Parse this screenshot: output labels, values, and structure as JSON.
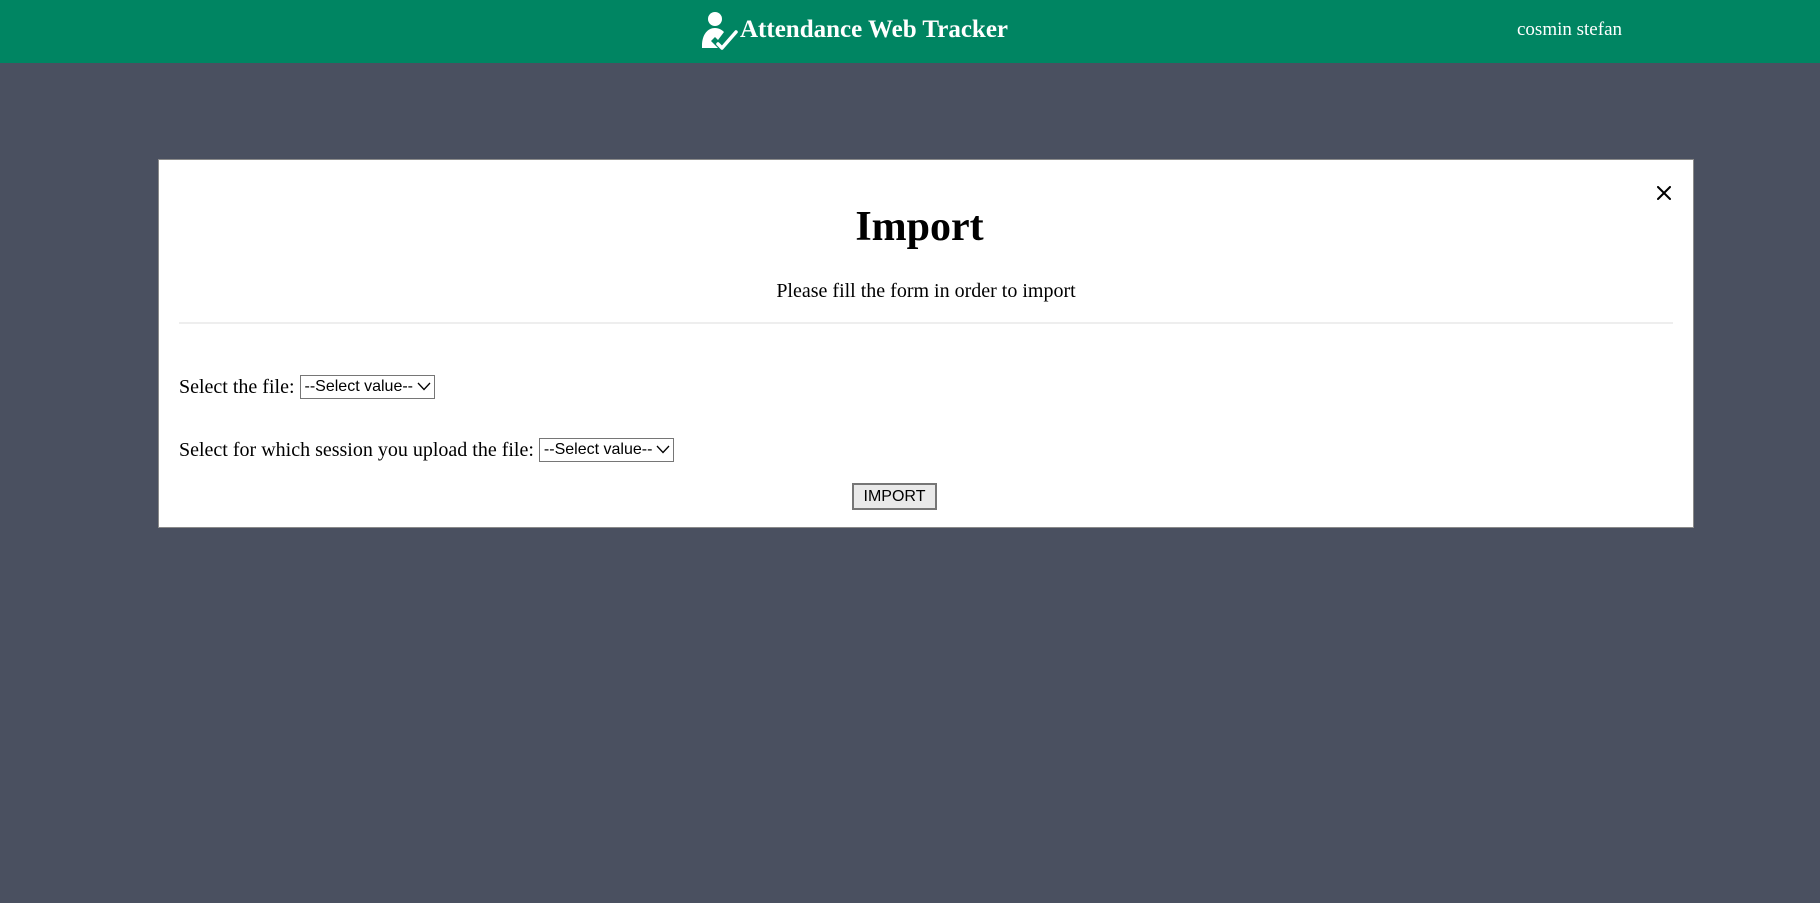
{
  "header": {
    "logo_icon": "user-check-icon",
    "title": "Attendance Web Tracker",
    "user_name": "cosmin stefan",
    "background_color": "#008562"
  },
  "modal": {
    "title": "Import",
    "subtitle": "Please fill the form in order to import",
    "close_icon": "close-icon",
    "fields": {
      "file": {
        "label": "Select the file:",
        "value": "--Select value--"
      },
      "session": {
        "label": "Select for which session you upload the file:",
        "value": "--Select value--"
      }
    },
    "submit_label": "IMPORT"
  },
  "colors": {
    "page_background": "#4a5060",
    "header": "#008562",
    "modal_background": "#ffffff"
  }
}
